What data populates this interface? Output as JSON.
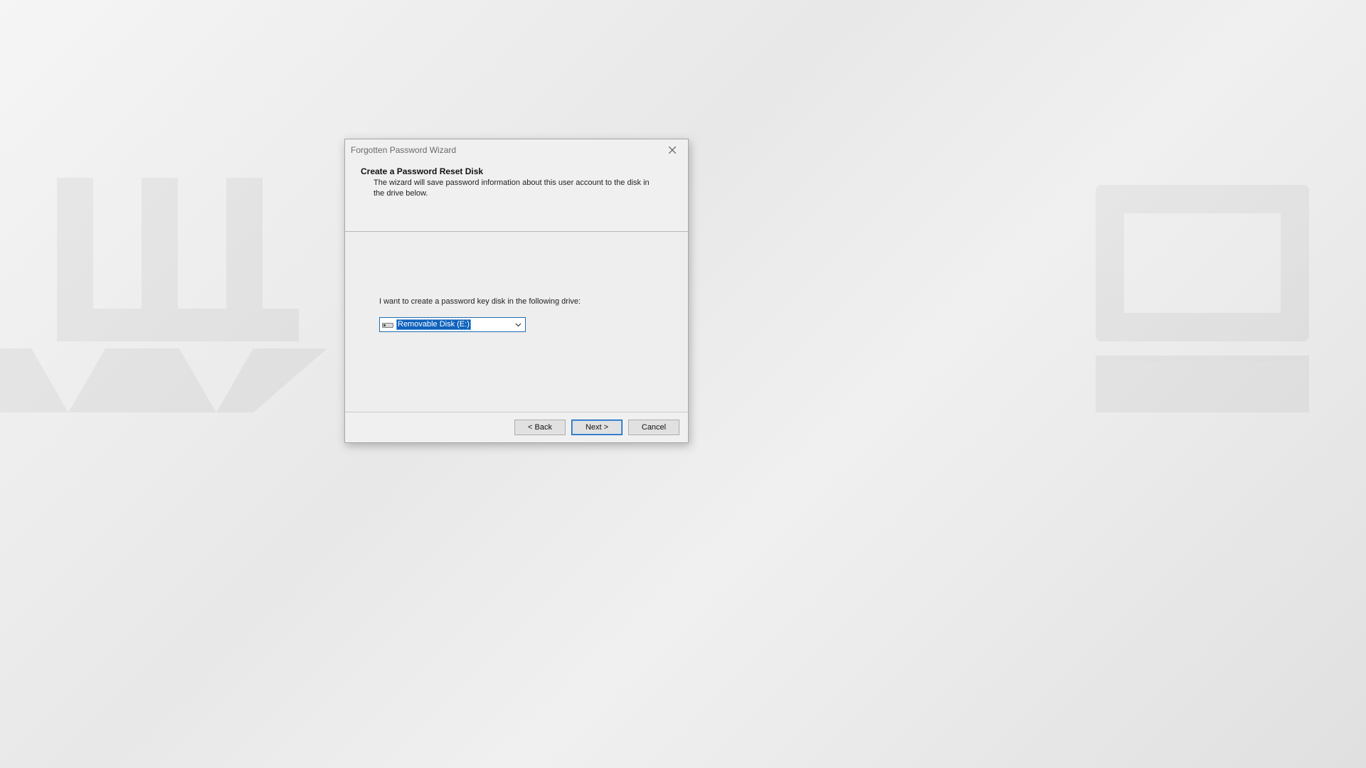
{
  "window": {
    "title": "Forgotten Password Wizard"
  },
  "header": {
    "title": "Create a Password Reset Disk",
    "subtitle": "The wizard will save password information about this user account to the disk in the drive below."
  },
  "body": {
    "prompt": "I want to create a password key disk in the following drive:",
    "drive_selected": "Removable Disk (E:)"
  },
  "footer": {
    "back": "< Back",
    "next": "Next >",
    "cancel": "Cancel"
  }
}
